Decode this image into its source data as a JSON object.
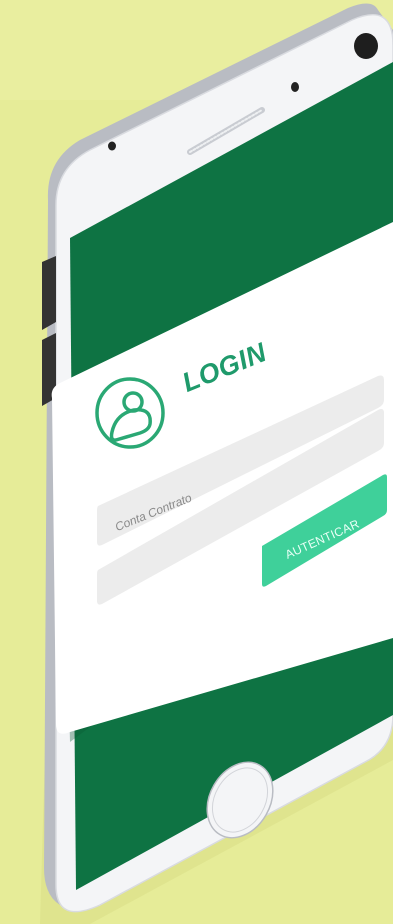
{
  "login": {
    "title": "LOGIN",
    "account_placeholder": "Conta Contrato",
    "password_placeholder": "",
    "submit_label": "AUTENTICAR"
  },
  "colors": {
    "background": "#e6ec98",
    "screen": "#0e7343",
    "accent": "#3fd09a",
    "title": "#1f9a6b",
    "field": "#ececec"
  },
  "icons": {
    "user": "user-circle-icon",
    "home": "home-button-icon",
    "camera": "front-camera-icon",
    "speaker": "speaker-grille-icon"
  }
}
